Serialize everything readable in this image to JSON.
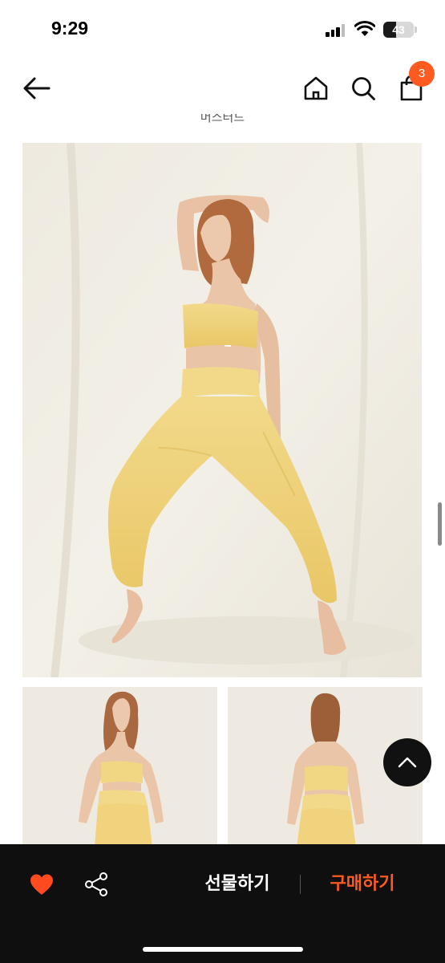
{
  "status_bar": {
    "time": "9:29",
    "battery_level": "43"
  },
  "top_nav": {
    "back_icon": "arrow-left-icon",
    "home_icon": "home-icon",
    "search_icon": "search-icon",
    "cart_icon": "shopping-bag-icon",
    "cart_badge_count": "3",
    "badge_color": "#ff5a1f"
  },
  "partial_caption": "머스터드",
  "product": {
    "color": "#f0d27a",
    "images": [
      "main-model-side-pose",
      "model-front-view",
      "model-back-view"
    ]
  },
  "scroll_top_icon": "chevron-up-icon",
  "bottom_bar": {
    "like_icon": "heart-icon",
    "like_color": "#ff4b1f",
    "share_icon": "share-icon",
    "gift_label": "선물하기",
    "buy_label": "구매하기",
    "buy_color": "#ff5a1f"
  }
}
